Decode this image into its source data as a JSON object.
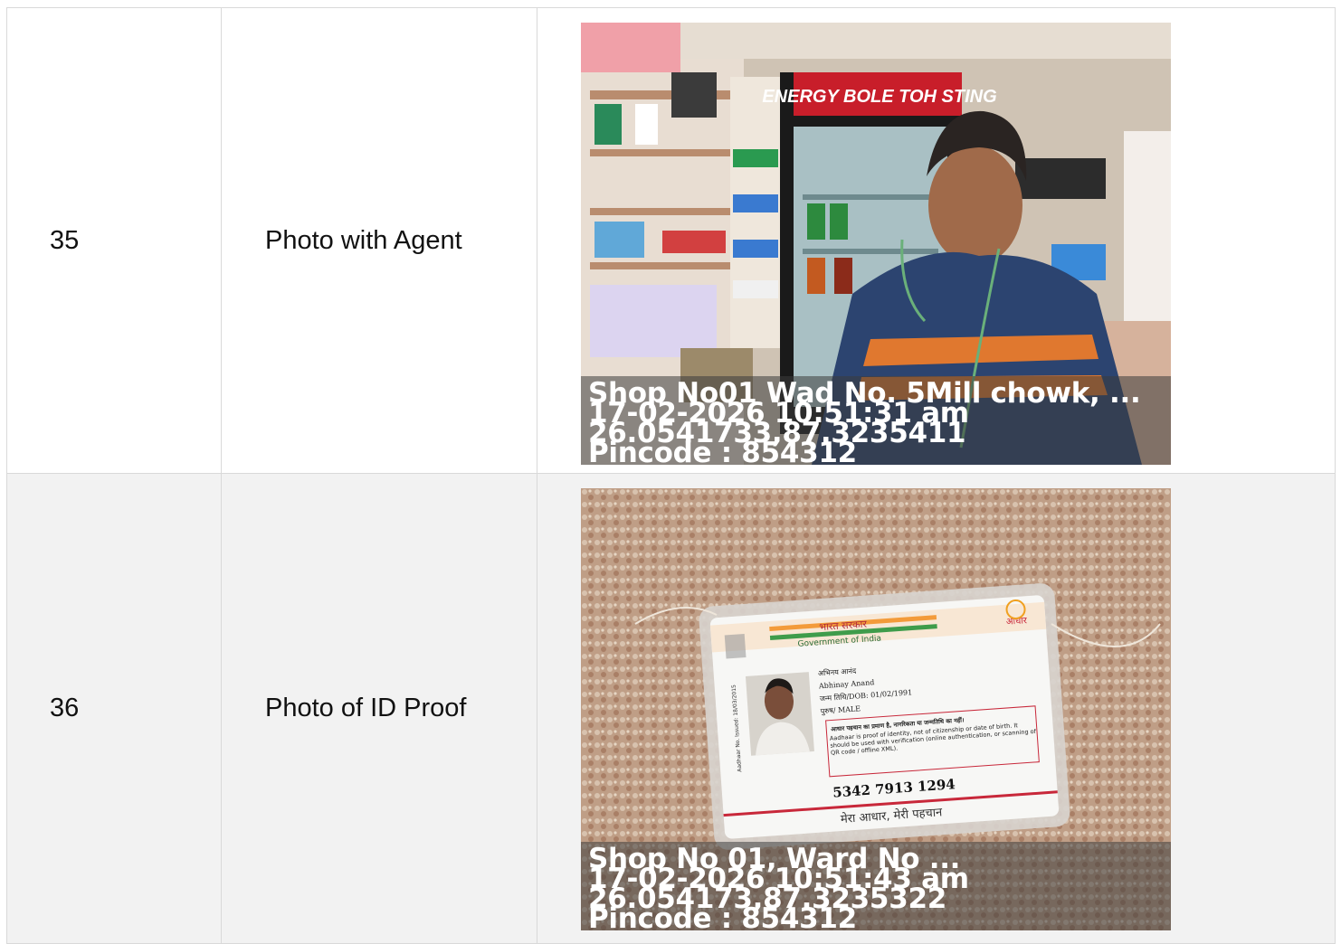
{
  "rows": [
    {
      "number": "35",
      "label": "Photo with Agent",
      "photo": {
        "description": "shop-agent-photo",
        "caption_lines": [
          "Shop No01 Wad No. 5Mill chowk, ...",
          "17-02-2026 10:51:31 am",
          "26.0541733,87.3235411",
          "Pincode : 854312"
        ],
        "sign_text": "ENERGY BOLE TOH STING"
      }
    },
    {
      "number": "36",
      "label": "Photo of ID Proof",
      "photo": {
        "description": "aadhaar-card-photo",
        "caption_lines": [
          "Shop No 01, Ward No ...",
          "17-02-2026 10:51:43 am",
          "26.054173,87.3235322",
          "Pincode : 854312"
        ],
        "card": {
          "gov_hi": "भारत सरकार",
          "gov_en": "Government of India",
          "aadhaar_logo": "आधार",
          "name_hi": "अभिनय आनंद",
          "name_en": "Abhinay Anand",
          "dob": "जन्म तिथि/DOB: 01/02/1991",
          "gender": "पुरुष/ MALE",
          "notice_hi": "आधार पहचान का प्रमाण है, नागरिकता या जन्मतिथि का नहीं।",
          "notice_en": "Aadhaar is proof of identity, not of citizenship or date of birth. It should be used with verification (online authentication, or scanning of QR code / offline XML).",
          "side_text": "Aadhaar No. Issued: 18/03/2015",
          "number": "5342 7913 1294",
          "tagline": "मेरा आधार, मेरी पहचान"
        }
      }
    }
  ]
}
